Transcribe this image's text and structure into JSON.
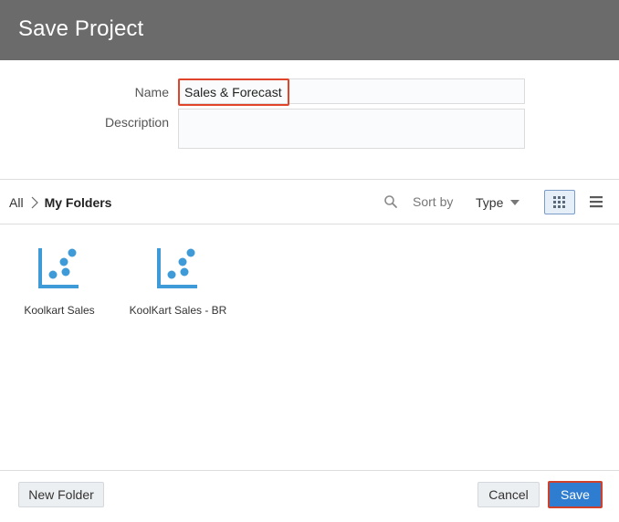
{
  "dialog": {
    "title": "Save Project"
  },
  "form": {
    "name_label": "Name",
    "name_value": "Sales & Forecast",
    "description_label": "Description",
    "description_value": ""
  },
  "browser": {
    "breadcrumb": {
      "root": "All",
      "current": "My Folders"
    },
    "sort_label": "Sort by",
    "sort_value": "Type",
    "view_mode": "grid"
  },
  "items": [
    {
      "label": "Koolkart Sales",
      "icon": "scatter-chart-icon"
    },
    {
      "label": "KoolKart Sales - BR",
      "icon": "scatter-chart-icon"
    }
  ],
  "footer": {
    "new_folder_label": "New Folder",
    "cancel_label": "Cancel",
    "save_label": "Save"
  },
  "colors": {
    "titlebar": "#6b6b6b",
    "accent": "#2f7dd1",
    "icon": "#3f9ad8",
    "highlight": "#e0442b"
  }
}
